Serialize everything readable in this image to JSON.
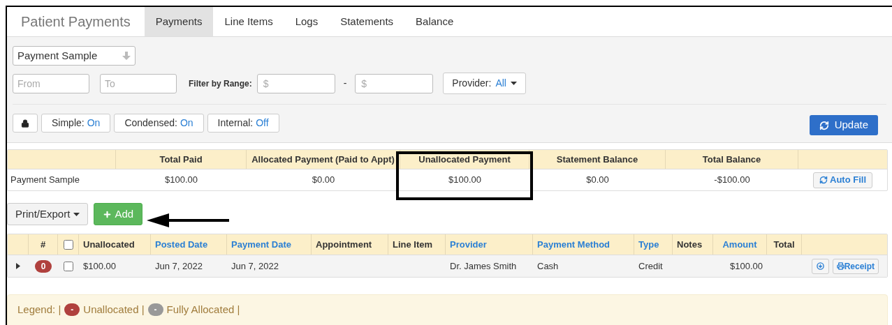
{
  "header": {
    "title": "Patient Payments",
    "tabs": [
      {
        "label": "Payments",
        "selected": true
      },
      {
        "label": "Line Items",
        "selected": false
      },
      {
        "label": "Logs",
        "selected": false
      },
      {
        "label": "Statements",
        "selected": false
      },
      {
        "label": "Balance",
        "selected": false
      }
    ]
  },
  "filters": {
    "patient_select": "Payment Sample",
    "from": {
      "placeholder": "From"
    },
    "to": {
      "placeholder": "To"
    },
    "range_label": "Filter by Range:",
    "range_min": {
      "placeholder": "$"
    },
    "range_separator": "-",
    "range_max": {
      "placeholder": "$"
    },
    "provider": {
      "label": "Provider:",
      "value": "All"
    }
  },
  "toggles": [
    {
      "label": "Simple:",
      "value": "On"
    },
    {
      "label": "Condensed:",
      "value": "On"
    },
    {
      "label": "Internal:",
      "value": "Off"
    }
  ],
  "update_button": "Update",
  "summary": {
    "columns": [
      "",
      "Total Paid",
      "Allocated Payment (Paid to Appt)",
      "Unallocated Payment",
      "Statement Balance",
      "Total Balance"
    ],
    "row": [
      "Payment Sample",
      "$100.00",
      "$0.00",
      "$100.00",
      "$0.00",
      "-$100.00"
    ],
    "action": "Auto Fill"
  },
  "actions": {
    "export": "Print/Export",
    "add": "Add"
  },
  "payments": {
    "columns": [
      {
        "kind": "blank"
      },
      {
        "kind": "plain",
        "label": "#"
      },
      {
        "kind": "checkbox",
        "checked": false
      },
      {
        "kind": "plain",
        "label": "Unallocated"
      },
      {
        "kind": "sortable",
        "label": "Posted Date"
      },
      {
        "kind": "sortable",
        "label": "Payment Date"
      },
      {
        "kind": "plain",
        "label": "Appointment"
      },
      {
        "kind": "plain",
        "label": "Line Item"
      },
      {
        "kind": "sortable",
        "label": "Provider"
      },
      {
        "kind": "sortable",
        "label": "Payment Method"
      },
      {
        "kind": "sortable",
        "label": "Type"
      },
      {
        "kind": "plain",
        "label": "Notes"
      },
      {
        "kind": "sortable",
        "label": "Amount"
      },
      {
        "kind": "plain",
        "label": "Total"
      }
    ],
    "rows": [
      {
        "expanded": false,
        "checked": false,
        "cells": [
          "",
          "0",
          "",
          "$100.00",
          "Jun 7, 2022",
          "Jun 7, 2022",
          "",
          "",
          "Dr. James Smith",
          "Cash",
          "Credit",
          "",
          "$100.00",
          ""
        ],
        "receipt": "Receipt"
      }
    ]
  },
  "legend": {
    "label": "Legend: |",
    "items": [
      {
        "badge": "-",
        "label": "Unallocated |",
        "color": "#b0413e"
      },
      {
        "badge": "-",
        "label": "Fully Allocated |",
        "color": "#999999"
      }
    ]
  }
}
